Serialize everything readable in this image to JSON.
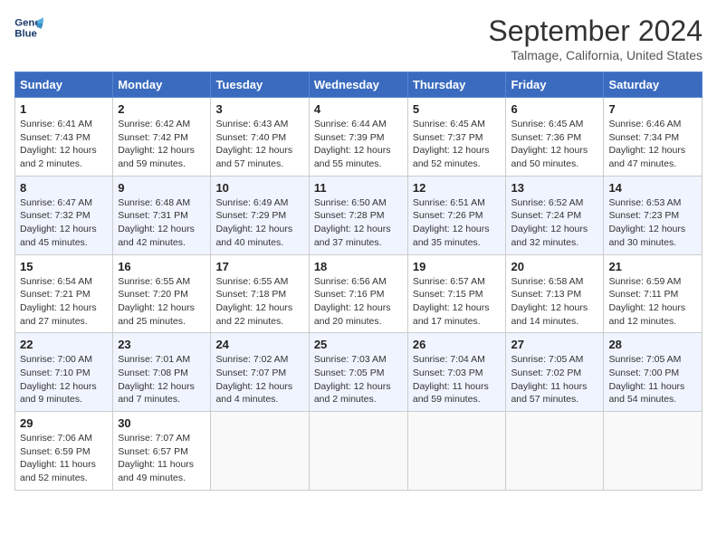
{
  "header": {
    "logo_line1": "General",
    "logo_line2": "Blue",
    "month": "September 2024",
    "location": "Talmage, California, United States"
  },
  "weekdays": [
    "Sunday",
    "Monday",
    "Tuesday",
    "Wednesday",
    "Thursday",
    "Friday",
    "Saturday"
  ],
  "weeks": [
    [
      {
        "day": "1",
        "sunrise": "6:41 AM",
        "sunset": "7:43 PM",
        "daylight": "12 hours and 2 minutes."
      },
      {
        "day": "2",
        "sunrise": "6:42 AM",
        "sunset": "7:42 PM",
        "daylight": "12 hours and 59 minutes."
      },
      {
        "day": "3",
        "sunrise": "6:43 AM",
        "sunset": "7:40 PM",
        "daylight": "12 hours and 57 minutes."
      },
      {
        "day": "4",
        "sunrise": "6:44 AM",
        "sunset": "7:39 PM",
        "daylight": "12 hours and 55 minutes."
      },
      {
        "day": "5",
        "sunrise": "6:45 AM",
        "sunset": "7:37 PM",
        "daylight": "12 hours and 52 minutes."
      },
      {
        "day": "6",
        "sunrise": "6:45 AM",
        "sunset": "7:36 PM",
        "daylight": "12 hours and 50 minutes."
      },
      {
        "day": "7",
        "sunrise": "6:46 AM",
        "sunset": "7:34 PM",
        "daylight": "12 hours and 47 minutes."
      }
    ],
    [
      {
        "day": "8",
        "sunrise": "6:47 AM",
        "sunset": "7:32 PM",
        "daylight": "12 hours and 45 minutes."
      },
      {
        "day": "9",
        "sunrise": "6:48 AM",
        "sunset": "7:31 PM",
        "daylight": "12 hours and 42 minutes."
      },
      {
        "day": "10",
        "sunrise": "6:49 AM",
        "sunset": "7:29 PM",
        "daylight": "12 hours and 40 minutes."
      },
      {
        "day": "11",
        "sunrise": "6:50 AM",
        "sunset": "7:28 PM",
        "daylight": "12 hours and 37 minutes."
      },
      {
        "day": "12",
        "sunrise": "6:51 AM",
        "sunset": "7:26 PM",
        "daylight": "12 hours and 35 minutes."
      },
      {
        "day": "13",
        "sunrise": "6:52 AM",
        "sunset": "7:24 PM",
        "daylight": "12 hours and 32 minutes."
      },
      {
        "day": "14",
        "sunrise": "6:53 AM",
        "sunset": "7:23 PM",
        "daylight": "12 hours and 30 minutes."
      }
    ],
    [
      {
        "day": "15",
        "sunrise": "6:54 AM",
        "sunset": "7:21 PM",
        "daylight": "12 hours and 27 minutes."
      },
      {
        "day": "16",
        "sunrise": "6:55 AM",
        "sunset": "7:20 PM",
        "daylight": "12 hours and 25 minutes."
      },
      {
        "day": "17",
        "sunrise": "6:55 AM",
        "sunset": "7:18 PM",
        "daylight": "12 hours and 22 minutes."
      },
      {
        "day": "18",
        "sunrise": "6:56 AM",
        "sunset": "7:16 PM",
        "daylight": "12 hours and 20 minutes."
      },
      {
        "day": "19",
        "sunrise": "6:57 AM",
        "sunset": "7:15 PM",
        "daylight": "12 hours and 17 minutes."
      },
      {
        "day": "20",
        "sunrise": "6:58 AM",
        "sunset": "7:13 PM",
        "daylight": "12 hours and 14 minutes."
      },
      {
        "day": "21",
        "sunrise": "6:59 AM",
        "sunset": "7:11 PM",
        "daylight": "12 hours and 12 minutes."
      }
    ],
    [
      {
        "day": "22",
        "sunrise": "7:00 AM",
        "sunset": "7:10 PM",
        "daylight": "12 hours and 9 minutes."
      },
      {
        "day": "23",
        "sunrise": "7:01 AM",
        "sunset": "7:08 PM",
        "daylight": "12 hours and 7 minutes."
      },
      {
        "day": "24",
        "sunrise": "7:02 AM",
        "sunset": "7:07 PM",
        "daylight": "12 hours and 4 minutes."
      },
      {
        "day": "25",
        "sunrise": "7:03 AM",
        "sunset": "7:05 PM",
        "daylight": "12 hours and 2 minutes."
      },
      {
        "day": "26",
        "sunrise": "7:04 AM",
        "sunset": "7:03 PM",
        "daylight": "11 hours and 59 minutes."
      },
      {
        "day": "27",
        "sunrise": "7:05 AM",
        "sunset": "7:02 PM",
        "daylight": "11 hours and 57 minutes."
      },
      {
        "day": "28",
        "sunrise": "7:05 AM",
        "sunset": "7:00 PM",
        "daylight": "11 hours and 54 minutes."
      }
    ],
    [
      {
        "day": "29",
        "sunrise": "7:06 AM",
        "sunset": "6:59 PM",
        "daylight": "11 hours and 52 minutes."
      },
      {
        "day": "30",
        "sunrise": "7:07 AM",
        "sunset": "6:57 PM",
        "daylight": "11 hours and 49 minutes."
      },
      null,
      null,
      null,
      null,
      null
    ]
  ]
}
